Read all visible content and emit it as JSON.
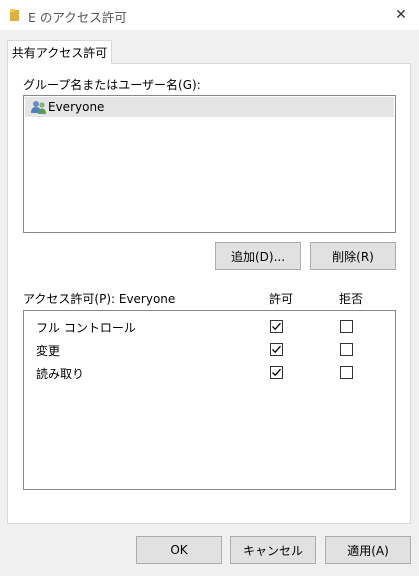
{
  "window": {
    "title": "E のアクセス許可",
    "close_glyph": "✕"
  },
  "tab": {
    "label": "共有アクセス許可"
  },
  "group": {
    "label": "グループ名またはユーザー名(G):",
    "items": [
      {
        "name": "Everyone",
        "icon": "users-icon",
        "selected": true
      }
    ]
  },
  "buttons": {
    "add": "追加(D)...",
    "remove": "削除(R)",
    "ok": "OK",
    "cancel": "キャンセル",
    "apply": "適用(A)"
  },
  "permissions": {
    "label": "アクセス許可(P): Everyone",
    "col_allow": "許可",
    "col_deny": "拒否",
    "rows": [
      {
        "name": "フル コントロール",
        "allow": true,
        "deny": false
      },
      {
        "name": "変更",
        "allow": true,
        "deny": false
      },
      {
        "name": "読み取り",
        "allow": true,
        "deny": false
      }
    ]
  }
}
